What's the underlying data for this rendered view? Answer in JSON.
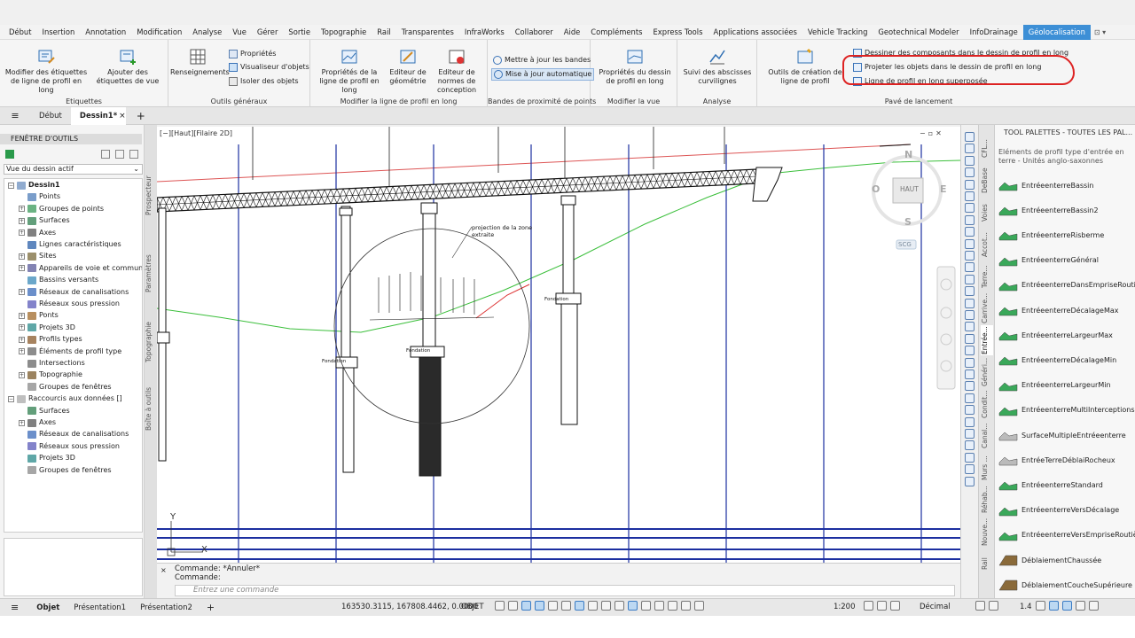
{
  "menubar": {
    "items": [
      "Début",
      "Insertion",
      "Annotation",
      "Modification",
      "Analyse",
      "Vue",
      "Gérer",
      "Sortie",
      "Topographie",
      "Rail",
      "Transparentes",
      "InfraWorks",
      "Collaborer",
      "Aide",
      "Compléments",
      "Express Tools",
      "Applications associées",
      "Vehicle Tracking",
      "Geotechnical Modeler",
      "InfoDrainage",
      "Géolocalisation"
    ],
    "active": "Géolocalisation"
  },
  "ribbon": {
    "etiquettes": {
      "title": "Etiquettes",
      "btn1": "Modifier des étiquettes de ligne de profil en long",
      "btn2": "Ajouter des étiquettes de vue"
    },
    "outils": {
      "title": "Outils généraux",
      "renseignements": "Renseignements",
      "proprietes": "Propriétés",
      "visualiseur": "Visualiseur d'objets",
      "isoler": "Isoler des objets"
    },
    "modifier": {
      "title": "Modifier la ligne de profil en long",
      "btn1": "Propriétés de la ligne de profil en long",
      "btn2": "Editeur de géométrie",
      "btn3": "Editeur de normes de conception"
    },
    "bandes": {
      "title": "Bandes de proximité de points",
      "maj": "Mettre à jour les bandes",
      "auto": "Mise à jour automatique"
    },
    "modvue": {
      "title": "Modifier la vue",
      "btn1": "Propriétés du dessin de profil en long"
    },
    "analyse": {
      "title": "Analyse",
      "btn1": "Suivi des abscisses curvilignes"
    },
    "pave": {
      "title": "Pavé de lancement",
      "outils": "Outils de création de ligne de profil",
      "dessiner": "Dessiner des composants dans le dessin de profil en long",
      "projeter": "Projeter les objets dans le dessin de profil en long",
      "superposee": "Ligne de profil en long superposée"
    }
  },
  "tabs": {
    "debut": "Début",
    "dessin": "Dessin1*"
  },
  "toolspace": {
    "header": "FENÊTRE D'OUTILS",
    "view": "Vue du dessin actif",
    "tree": [
      "Dessin1",
      "Points",
      "Groupes de points",
      "Surfaces",
      "Axes",
      "Lignes caractéristiques",
      "Sites",
      "Appareils de voie et communi...",
      "Bassins versants",
      "Réseaux de canalisations",
      "Réseaux sous pression",
      "Ponts",
      "Projets 3D",
      "Profils types",
      "Éléments de profil type",
      "Intersections",
      "Topographie",
      "Groupes de fenêtres",
      "Raccourcis aux données []",
      "Surfaces",
      "Axes",
      "Réseaux de canalisations",
      "Réseaux sous pression",
      "Projets 3D",
      "Groupes de fenêtres"
    ],
    "sidetabs": [
      "Prospecteur",
      "Paramètres",
      "Topographie",
      "Boîte à outils"
    ]
  },
  "canvas": {
    "viewlabel": "[−][Haut][Filaire 2D]",
    "annotation": "projection de la zone extraite",
    "fondation": "Fondation",
    "compass": {
      "n": "N",
      "s": "S",
      "e": "E",
      "o": "O",
      "top": "HAUT",
      "ucs": "SCG"
    }
  },
  "command": {
    "hist1": "Commande: *Annuler*",
    "hist2": "Commande:",
    "placeholder": "Entrez une commande"
  },
  "palette": {
    "title": "TOOL PALETTES - TOUTES LES PAL...",
    "subtitle": "Eléments de profil type d'entrée en terre - Unités anglo-saxonnes",
    "vtabs": [
      "CFL...",
      "DeBase",
      "Voies",
      "Accot...",
      "Terre...",
      "Carrive...",
      "Entrée...",
      "Généri...",
      "Condit...",
      "Canal...",
      "Murs ...",
      "Réhab...",
      "Nouve...",
      "Rail"
    ],
    "items": [
      "EntréeenterreBassin",
      "EntréeenterreBassin2",
      "EntréeenterreRisberme",
      "EntréeenterreGénéral",
      "EntréeenterreDansEmpriseRoutière",
      "EntréeenterreDécalageMax",
      "EntréeenterreLargeurMax",
      "EntréeenterreDécalageMin",
      "EntréeenterreLargeurMin",
      "EntréeenterreMultiInterceptions",
      "SurfaceMultipleEntréeenterre",
      "EntréeTerreDéblaiRocheux",
      "EntréeenterreStandard",
      "EntréeenterreVersDécalage",
      "EntréeenterreVersEmpriseRoutière",
      "DéblaiementChaussée",
      "DéblaiementCoucheSupérieure"
    ]
  },
  "status": {
    "tabs": [
      "Objet",
      "Présentation1",
      "Présentation2"
    ],
    "coords": "163530.3115, 167808.4462, 0.0000",
    "mode": "OBJET",
    "scale": "1:200",
    "units": "Décimal",
    "lw": "1.4"
  }
}
